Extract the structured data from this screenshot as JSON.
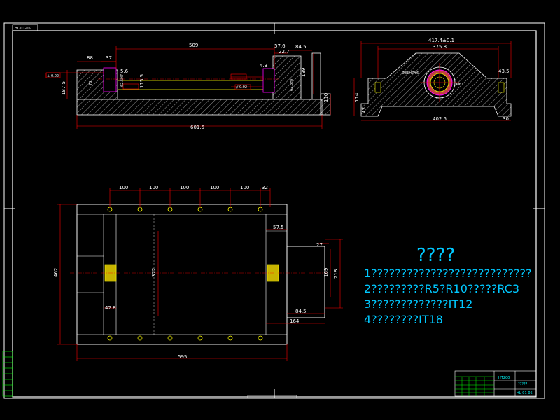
{
  "drawing_number_top": "HL-01-05",
  "dims_front": {
    "len_top": "509",
    "d88": "88",
    "d37": "37",
    "d5_6": "5.6",
    "d57_6": "57.6",
    "d22_7": "22.7",
    "d84_5": "84.5",
    "d4_3": "4.3",
    "d139": "139",
    "d110": "110",
    "d187_5": "187.5",
    "d115_5": "115.5",
    "d70": "70",
    "d601_5": "601.5",
    "r1": "62.5H7",
    "r2": "62.5H7",
    "tol1": "⊥ 0.02",
    "tol2": "// 0.02"
  },
  "dims_side": {
    "width": "417.4±0.1",
    "inner": "375.8",
    "d43_5": "43.5",
    "d114": "114",
    "d43": "43",
    "d402_5": "402.5",
    "d30": "30",
    "bore": "Ø63",
    "bore2": "Ø85H7/r6"
  },
  "dims_plan": {
    "pitch": [
      "100",
      "100",
      "100",
      "100",
      "100",
      "32"
    ],
    "d57_5": "57.5",
    "d27": "27",
    "d372": "372",
    "d462": "462",
    "d169": "169",
    "d218": "218",
    "d42_8": "42.8",
    "d84_5": "84.5",
    "d164": "164",
    "d595": "595"
  },
  "notes": {
    "title": "????",
    "lines": [
      "1???????????????????????????",
      "2?????????R5?R10?????RC3",
      "3?????????????IT12",
      "4????????IT18"
    ]
  },
  "title_block": {
    "material": "HT200",
    "name": "?????",
    "drawing_no": "HL-01-05"
  }
}
